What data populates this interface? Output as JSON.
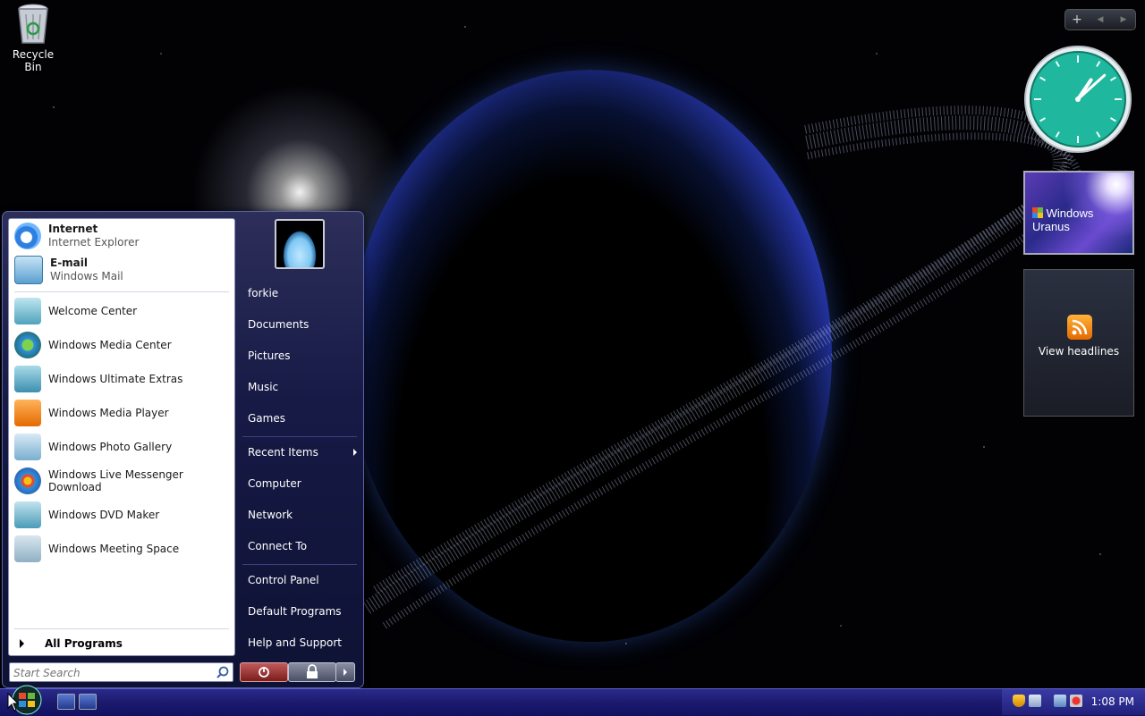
{
  "desktop": {
    "icons": [
      {
        "label": "Recycle Bin",
        "icon": "recycle-bin-icon"
      }
    ]
  },
  "gadgets": {
    "sidebar_controls": {
      "add": "+",
      "prev": "◀",
      "next": "▶"
    },
    "clock": {
      "hour": 1,
      "minute": 8
    },
    "slideshow": {
      "text": "Windows Uranus"
    },
    "feed_headlines": {
      "label": "View headlines",
      "icon": "rss-icon"
    }
  },
  "start_menu": {
    "pinned": [
      {
        "title": "Internet",
        "subtitle": "Internet Explorer",
        "icon": "internet-explorer-icon"
      },
      {
        "title": "E-mail",
        "subtitle": "Windows Mail",
        "icon": "windows-mail-icon"
      }
    ],
    "recent": [
      {
        "label": "Welcome Center",
        "icon": "welcome-center-icon"
      },
      {
        "label": "Windows Media Center",
        "icon": "media-center-icon"
      },
      {
        "label": "Windows Ultimate Extras",
        "icon": "ultimate-extras-icon"
      },
      {
        "label": "Windows Media Player",
        "icon": "media-player-icon"
      },
      {
        "label": "Windows Photo Gallery",
        "icon": "photo-gallery-icon"
      },
      {
        "label": "Windows Live Messenger Download",
        "icon": "live-messenger-icon"
      },
      {
        "label": "Windows DVD Maker",
        "icon": "dvd-maker-icon"
      },
      {
        "label": "Windows Meeting Space",
        "icon": "meeting-space-icon"
      }
    ],
    "all_programs": "All Programs",
    "search_placeholder": "Start Search",
    "right": {
      "user": "forkie",
      "group1": [
        "Documents",
        "Pictures",
        "Music",
        "Games"
      ],
      "group2": [
        "Recent Items",
        "Computer",
        "Network",
        "Connect To"
      ],
      "group3": [
        "Control Panel",
        "Default Programs",
        "Help and Support"
      ]
    }
  },
  "taskbar": {
    "clock": "1:08 PM"
  },
  "colors": {
    "taskbar": "#1b1a6e",
    "start_menu": "#161a45",
    "clock_face": "#1fb79d"
  }
}
